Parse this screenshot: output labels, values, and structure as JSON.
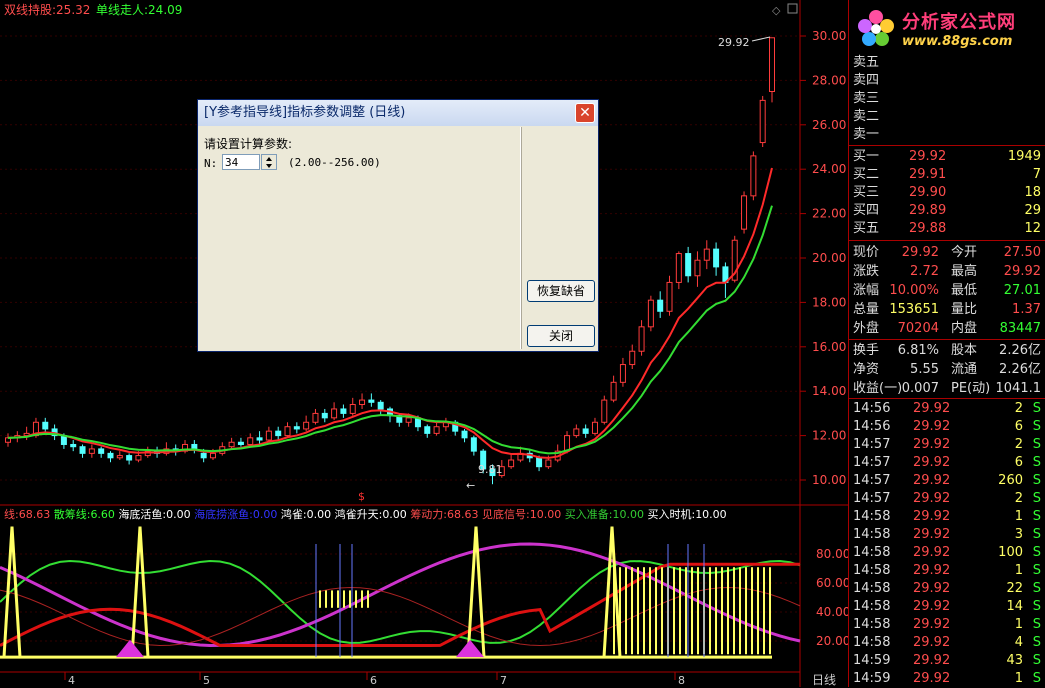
{
  "top_legend": [
    {
      "label": "双线持股:",
      "value": "25.32",
      "color": "#ff4d4d"
    },
    {
      "label": "单线走人:",
      "value": "24.09",
      "color": "#33ff33"
    }
  ],
  "price_axis": {
    "ticks": [
      "30.00",
      "28.00",
      "26.00",
      "24.00",
      "22.00",
      "20.00",
      "18.00",
      "16.00",
      "14.00",
      "12.00",
      "10.00"
    ]
  },
  "annotations": {
    "high_label": "29.92",
    "low_label": "9.81"
  },
  "lower_legend": [
    {
      "label": "线:",
      "value": "68.63",
      "color": "#ff4d4d"
    },
    {
      "label": "散筹线:",
      "value": "6.60",
      "color": "#33ff33"
    },
    {
      "label": "海底活鱼:",
      "value": "0.00",
      "color": "#ffffff"
    },
    {
      "label": "海底捞涨鱼:",
      "value": "0.00",
      "color": "#3333ff"
    },
    {
      "label": "鸿雀:",
      "value": "0.00",
      "color": "#ffffff"
    },
    {
      "label": "鸿雀升天:",
      "value": "0.00",
      "color": "#ffffff"
    },
    {
      "label": "筹动力:",
      "value": "68.63",
      "color": "#ff4d4d"
    },
    {
      "label": "见底信号:",
      "value": "10.00",
      "color": "#ff4d4d"
    },
    {
      "label": "买入准备:",
      "value": "10.00",
      "color": "#33cc33"
    },
    {
      "label": "买入时机:",
      "value": "10.00",
      "color": "#ffffff"
    }
  ],
  "lower_axis": {
    "ticks": [
      "80.00",
      "60.00",
      "40.00",
      "20.00"
    ]
  },
  "x_axis": {
    "labels": [
      "4",
      "5",
      "6",
      "7",
      "8"
    ],
    "period": "日线"
  },
  "logo": {
    "title": "分析家公式网",
    "url": "www.88gs.com"
  },
  "order_book": {
    "sell": [
      {
        "label": "卖五"
      },
      {
        "label": "卖四"
      },
      {
        "label": "卖三"
      },
      {
        "label": "卖二"
      },
      {
        "label": "卖一"
      }
    ],
    "buy": [
      {
        "label": "买一",
        "price": "29.92",
        "vol": "1949"
      },
      {
        "label": "买二",
        "price": "29.91",
        "vol": "7"
      },
      {
        "label": "买三",
        "price": "29.90",
        "vol": "18"
      },
      {
        "label": "买四",
        "price": "29.89",
        "vol": "29"
      },
      {
        "label": "买五",
        "price": "29.88",
        "vol": "12"
      }
    ]
  },
  "stats": [
    {
      "l1": "现价",
      "v1": "29.92",
      "l2": "今开",
      "v2": "27.50"
    },
    {
      "l1": "涨跌",
      "v1": "2.72",
      "l2": "最高",
      "v2": "29.92"
    },
    {
      "l1": "涨幅",
      "v1": "10.00%",
      "l2": "最低",
      "v2": "27.01"
    },
    {
      "l1": "总量",
      "v1": "153651",
      "l2": "量比",
      "v2": "1.37"
    },
    {
      "l1": "外盘",
      "v1": "70204",
      "l2": "内盘",
      "v2": "83447"
    }
  ],
  "stats2": [
    {
      "l1": "换手",
      "v1": "6.81%",
      "l2": "股本",
      "v2": "2.26亿"
    },
    {
      "l1": "净资",
      "v1": "5.55",
      "l2": "流通",
      "v2": "2.26亿"
    },
    {
      "l1": "收益(一)",
      "v1": "0.007",
      "l2": "PE(动)",
      "v2": "1041.1"
    }
  ],
  "ticks": [
    {
      "time": "14:56",
      "price": "29.92",
      "vol": "2",
      "side": "S"
    },
    {
      "time": "14:56",
      "price": "29.92",
      "vol": "6",
      "side": "S"
    },
    {
      "time": "14:57",
      "price": "29.92",
      "vol": "2",
      "side": "S"
    },
    {
      "time": "14:57",
      "price": "29.92",
      "vol": "6",
      "side": "S"
    },
    {
      "time": "14:57",
      "price": "29.92",
      "vol": "260",
      "side": "S"
    },
    {
      "time": "14:57",
      "price": "29.92",
      "vol": "2",
      "side": "S"
    },
    {
      "time": "14:58",
      "price": "29.92",
      "vol": "1",
      "side": "S"
    },
    {
      "time": "14:58",
      "price": "29.92",
      "vol": "3",
      "side": "S"
    },
    {
      "time": "14:58",
      "price": "29.92",
      "vol": "100",
      "side": "S"
    },
    {
      "time": "14:58",
      "price": "29.92",
      "vol": "1",
      "side": "S"
    },
    {
      "time": "14:58",
      "price": "29.92",
      "vol": "22",
      "side": "S"
    },
    {
      "time": "14:58",
      "price": "29.92",
      "vol": "14",
      "side": "S"
    },
    {
      "time": "14:58",
      "price": "29.92",
      "vol": "1",
      "side": "S"
    },
    {
      "time": "14:58",
      "price": "29.92",
      "vol": "4",
      "side": "S"
    },
    {
      "time": "14:59",
      "price": "29.92",
      "vol": "43",
      "side": "S"
    },
    {
      "time": "14:59",
      "price": "29.92",
      "vol": "1",
      "side": "S"
    }
  ],
  "dialog": {
    "title": "[Y参考指导线]指标参数调整 (日线)",
    "prompt": "请设置计算参数:",
    "n_label": "N:",
    "n_value": "34",
    "range": "(2.00--256.00)",
    "restore_label": "恢复缺省",
    "close_label": "关闭"
  },
  "chart_data": {
    "type": "candlestick",
    "ylim": [
      9.4,
      30.8
    ],
    "candles": [
      {
        "o": 11.7,
        "c": 11.9,
        "h": 12.1,
        "l": 11.5
      },
      {
        "o": 11.9,
        "c": 12.0,
        "h": 12.2,
        "l": 11.7
      },
      {
        "o": 12.0,
        "c": 12.1,
        "h": 12.4,
        "l": 11.8
      },
      {
        "o": 12.0,
        "c": 12.6,
        "h": 12.8,
        "l": 11.9
      },
      {
        "o": 12.6,
        "c": 12.3,
        "h": 12.8,
        "l": 12.1
      },
      {
        "o": 12.3,
        "c": 12.0,
        "h": 12.5,
        "l": 11.8
      },
      {
        "o": 12.0,
        "c": 11.6,
        "h": 12.1,
        "l": 11.4
      },
      {
        "o": 11.6,
        "c": 11.5,
        "h": 11.8,
        "l": 11.3
      },
      {
        "o": 11.5,
        "c": 11.2,
        "h": 11.6,
        "l": 11.0
      },
      {
        "o": 11.2,
        "c": 11.4,
        "h": 11.6,
        "l": 11.0
      },
      {
        "o": 11.4,
        "c": 11.2,
        "h": 11.5,
        "l": 11.0
      },
      {
        "o": 11.2,
        "c": 11.0,
        "h": 11.3,
        "l": 10.8
      },
      {
        "o": 11.0,
        "c": 11.1,
        "h": 11.3,
        "l": 10.9
      },
      {
        "o": 11.1,
        "c": 10.9,
        "h": 11.2,
        "l": 10.7
      },
      {
        "o": 10.9,
        "c": 11.1,
        "h": 11.3,
        "l": 10.8
      },
      {
        "o": 11.1,
        "c": 11.3,
        "h": 11.5,
        "l": 11.0
      },
      {
        "o": 11.3,
        "c": 11.2,
        "h": 11.5,
        "l": 11.0
      },
      {
        "o": 11.2,
        "c": 11.4,
        "h": 11.7,
        "l": 11.1
      },
      {
        "o": 11.4,
        "c": 11.3,
        "h": 11.6,
        "l": 11.1
      },
      {
        "o": 11.3,
        "c": 11.6,
        "h": 11.8,
        "l": 11.2
      },
      {
        "o": 11.6,
        "c": 11.4,
        "h": 11.8,
        "l": 11.2
      },
      {
        "o": 11.2,
        "c": 11.0,
        "h": 11.4,
        "l": 10.8
      },
      {
        "o": 11.0,
        "c": 11.2,
        "h": 11.4,
        "l": 10.9
      },
      {
        "o": 11.2,
        "c": 11.5,
        "h": 11.7,
        "l": 11.1
      },
      {
        "o": 11.5,
        "c": 11.7,
        "h": 11.9,
        "l": 11.4
      },
      {
        "o": 11.7,
        "c": 11.6,
        "h": 11.9,
        "l": 11.5
      },
      {
        "o": 11.6,
        "c": 11.9,
        "h": 12.1,
        "l": 11.5
      },
      {
        "o": 11.9,
        "c": 11.8,
        "h": 12.2,
        "l": 11.6
      },
      {
        "o": 11.8,
        "c": 12.2,
        "h": 12.4,
        "l": 11.7
      },
      {
        "o": 12.2,
        "c": 12.0,
        "h": 12.4,
        "l": 11.8
      },
      {
        "o": 12.0,
        "c": 12.4,
        "h": 12.6,
        "l": 11.9
      },
      {
        "o": 12.4,
        "c": 12.3,
        "h": 12.6,
        "l": 12.1
      },
      {
        "o": 12.3,
        "c": 12.6,
        "h": 12.9,
        "l": 12.2
      },
      {
        "o": 12.6,
        "c": 13.0,
        "h": 13.2,
        "l": 12.5
      },
      {
        "o": 13.0,
        "c": 12.8,
        "h": 13.2,
        "l": 12.6
      },
      {
        "o": 12.8,
        "c": 13.2,
        "h": 13.5,
        "l": 12.7
      },
      {
        "o": 13.2,
        "c": 13.0,
        "h": 13.4,
        "l": 12.8
      },
      {
        "o": 13.0,
        "c": 13.4,
        "h": 13.7,
        "l": 12.9
      },
      {
        "o": 13.4,
        "c": 13.6,
        "h": 13.9,
        "l": 13.2
      },
      {
        "o": 13.6,
        "c": 13.5,
        "h": 13.9,
        "l": 13.3
      },
      {
        "o": 13.5,
        "c": 13.2,
        "h": 13.6,
        "l": 12.9
      },
      {
        "o": 13.2,
        "c": 12.9,
        "h": 13.3,
        "l": 12.6
      },
      {
        "o": 12.9,
        "c": 12.6,
        "h": 13.0,
        "l": 12.4
      },
      {
        "o": 12.6,
        "c": 12.8,
        "h": 13.0,
        "l": 12.4
      },
      {
        "o": 12.8,
        "c": 12.4,
        "h": 12.9,
        "l": 12.2
      },
      {
        "o": 12.4,
        "c": 12.1,
        "h": 12.5,
        "l": 11.9
      },
      {
        "o": 12.1,
        "c": 12.4,
        "h": 12.6,
        "l": 12.0
      },
      {
        "o": 12.4,
        "c": 12.6,
        "h": 12.8,
        "l": 12.2
      },
      {
        "o": 12.6,
        "c": 12.2,
        "h": 12.7,
        "l": 12.0
      },
      {
        "o": 12.2,
        "c": 11.9,
        "h": 12.3,
        "l": 11.7
      },
      {
        "o": 11.9,
        "c": 11.3,
        "h": 12.0,
        "l": 11.1
      },
      {
        "o": 11.3,
        "c": 10.5,
        "h": 11.4,
        "l": 10.3
      },
      {
        "o": 10.5,
        "c": 10.2,
        "h": 10.7,
        "l": 9.81
      },
      {
        "o": 10.2,
        "c": 10.6,
        "h": 10.9,
        "l": 10.1
      },
      {
        "o": 10.6,
        "c": 10.9,
        "h": 11.2,
        "l": 10.5
      },
      {
        "o": 10.9,
        "c": 11.2,
        "h": 11.5,
        "l": 10.8
      },
      {
        "o": 11.2,
        "c": 11.0,
        "h": 11.4,
        "l": 10.8
      },
      {
        "o": 11.0,
        "c": 10.6,
        "h": 11.1,
        "l": 10.4
      },
      {
        "o": 10.6,
        "c": 10.9,
        "h": 11.1,
        "l": 10.5
      },
      {
        "o": 10.9,
        "c": 11.3,
        "h": 11.6,
        "l": 10.8
      },
      {
        "o": 11.3,
        "c": 12.0,
        "h": 12.2,
        "l": 11.2
      },
      {
        "o": 12.0,
        "c": 12.3,
        "h": 12.5,
        "l": 11.9
      },
      {
        "o": 12.3,
        "c": 12.1,
        "h": 12.5,
        "l": 11.9
      },
      {
        "o": 12.1,
        "c": 12.6,
        "h": 12.8,
        "l": 12.0
      },
      {
        "o": 12.6,
        "c": 13.6,
        "h": 13.8,
        "l": 12.5
      },
      {
        "o": 13.6,
        "c": 14.4,
        "h": 14.7,
        "l": 13.5
      },
      {
        "o": 14.4,
        "c": 15.2,
        "h": 15.5,
        "l": 14.2
      },
      {
        "o": 15.2,
        "c": 15.8,
        "h": 16.1,
        "l": 15.0
      },
      {
        "o": 15.8,
        "c": 16.9,
        "h": 17.2,
        "l": 15.6
      },
      {
        "o": 16.9,
        "c": 18.1,
        "h": 18.3,
        "l": 16.7
      },
      {
        "o": 18.1,
        "c": 17.6,
        "h": 18.5,
        "l": 17.3
      },
      {
        "o": 17.6,
        "c": 18.9,
        "h": 19.2,
        "l": 17.4
      },
      {
        "o": 18.9,
        "c": 20.2,
        "h": 20.3,
        "l": 18.6
      },
      {
        "o": 20.2,
        "c": 19.2,
        "h": 20.5,
        "l": 18.9
      },
      {
        "o": 19.2,
        "c": 19.9,
        "h": 20.3,
        "l": 18.7
      },
      {
        "o": 19.9,
        "c": 20.4,
        "h": 20.8,
        "l": 19.5
      },
      {
        "o": 20.4,
        "c": 19.6,
        "h": 20.7,
        "l": 19.2
      },
      {
        "o": 19.6,
        "c": 18.9,
        "h": 19.8,
        "l": 18.2
      },
      {
        "o": 19.0,
        "c": 20.8,
        "h": 21.0,
        "l": 18.9
      },
      {
        "o": 21.3,
        "c": 22.8,
        "h": 23.0,
        "l": 21.1
      },
      {
        "o": 22.8,
        "c": 24.6,
        "h": 24.8,
        "l": 22.6
      },
      {
        "o": 25.2,
        "c": 27.1,
        "h": 27.3,
        "l": 25.0
      },
      {
        "o": 27.5,
        "c": 29.92,
        "h": 29.92,
        "l": 27.01
      }
    ]
  }
}
